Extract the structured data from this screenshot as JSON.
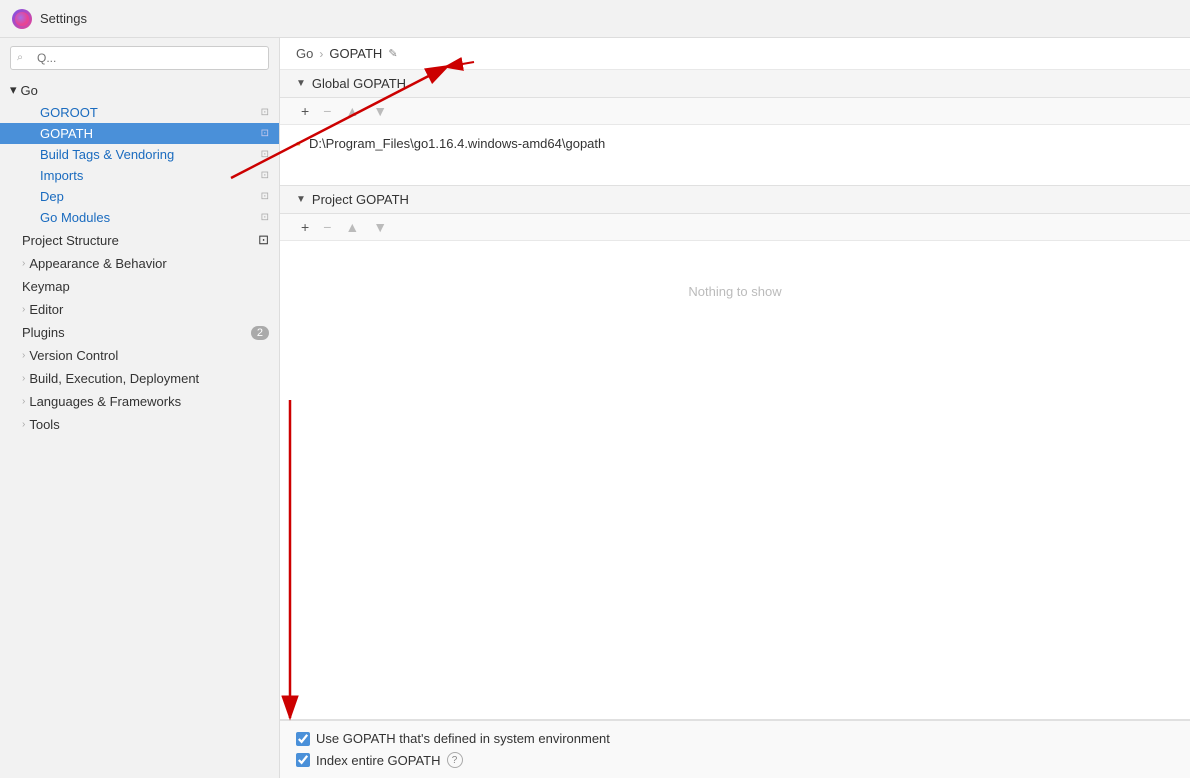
{
  "titleBar": {
    "title": "Settings",
    "iconLabel": "G"
  },
  "sidebar": {
    "searchPlaceholder": "Q...",
    "goSection": {
      "label": "Go",
      "expanded": true,
      "items": [
        {
          "id": "goroot",
          "label": "GOROOT",
          "active": false
        },
        {
          "id": "gopath",
          "label": "GOPATH",
          "active": true
        },
        {
          "id": "build-tags",
          "label": "Build Tags & Vendoring",
          "active": false
        },
        {
          "id": "imports",
          "label": "Imports",
          "active": false
        },
        {
          "id": "dep",
          "label": "Dep",
          "active": false
        },
        {
          "id": "go-modules",
          "label": "Go Modules",
          "active": false
        }
      ]
    },
    "topItems": [
      {
        "id": "project-structure",
        "label": "Project Structure",
        "badge": null,
        "expandable": false
      },
      {
        "id": "appearance-behavior",
        "label": "Appearance & Behavior",
        "badge": null,
        "expandable": true
      },
      {
        "id": "keymap",
        "label": "Keymap",
        "badge": null,
        "expandable": false
      },
      {
        "id": "editor",
        "label": "Editor",
        "badge": null,
        "expandable": true
      },
      {
        "id": "plugins",
        "label": "Plugins",
        "badge": "2",
        "expandable": false
      },
      {
        "id": "version-control",
        "label": "Version Control",
        "badge": null,
        "expandable": true
      },
      {
        "id": "build-execution",
        "label": "Build, Execution, Deployment",
        "badge": null,
        "expandable": true
      },
      {
        "id": "languages-frameworks",
        "label": "Languages & Frameworks",
        "badge": null,
        "expandable": true
      },
      {
        "id": "tools",
        "label": "Tools",
        "badge": null,
        "expandable": true
      }
    ]
  },
  "content": {
    "breadcrumb": {
      "parent": "Go",
      "separator": "›",
      "current": "GOPATH",
      "editIcon": "✎"
    },
    "globalGopath": {
      "sectionTitle": "Global GOPATH",
      "toolbar": {
        "add": "+",
        "remove": "−",
        "up": "▲",
        "down": "▼"
      },
      "entries": [
        {
          "path": "D:\\Program_Files\\go1.16.4.windows-amd64\\gopath"
        }
      ]
    },
    "projectGopath": {
      "sectionTitle": "Project GOPATH",
      "toolbar": {
        "add": "+",
        "remove": "−",
        "up": "▲",
        "down": "▼"
      },
      "emptyText": "Nothing to show"
    },
    "footer": {
      "checkboxes": [
        {
          "id": "use-system-gopath",
          "label": "Use GOPATH that's defined in system environment",
          "checked": true
        },
        {
          "id": "index-entire-gopath",
          "label": "Index entire GOPATH",
          "checked": true,
          "hasHelp": true
        }
      ]
    }
  },
  "icons": {
    "folder": "📁",
    "chevronRight": "›",
    "chevronDown": "▾",
    "triangleDown": "▼",
    "search": "🔍"
  }
}
